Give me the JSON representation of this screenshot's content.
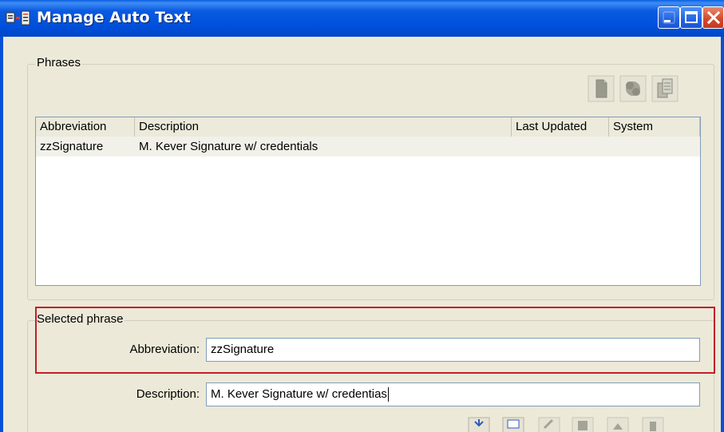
{
  "window": {
    "title": "Manage Auto Text"
  },
  "phrases": {
    "group_label": "Phrases",
    "columns": [
      "Abbreviation",
      "Description",
      "Last Updated",
      "System"
    ],
    "rows": [
      {
        "abbreviation": "zzSignature",
        "description": "M. Kever Signature w/ credentials",
        "last_updated": "",
        "system": ""
      }
    ],
    "toolbar_icons": [
      "new-phrase-icon",
      "delete-phrase-icon",
      "copy-phrase-icon"
    ]
  },
  "selected_phrase": {
    "group_label": "Selected phrase",
    "abbreviation_label": "Abbreviation:",
    "abbreviation_value": "zzSignature",
    "description_label": "Description:",
    "description_value": "M. Kever Signature w/ credentias"
  },
  "colors": {
    "titlebar": "#0054e3",
    "dialog": "#ece9d8",
    "highlight": "#c0202a",
    "row_selected": "#f1f1ea"
  }
}
